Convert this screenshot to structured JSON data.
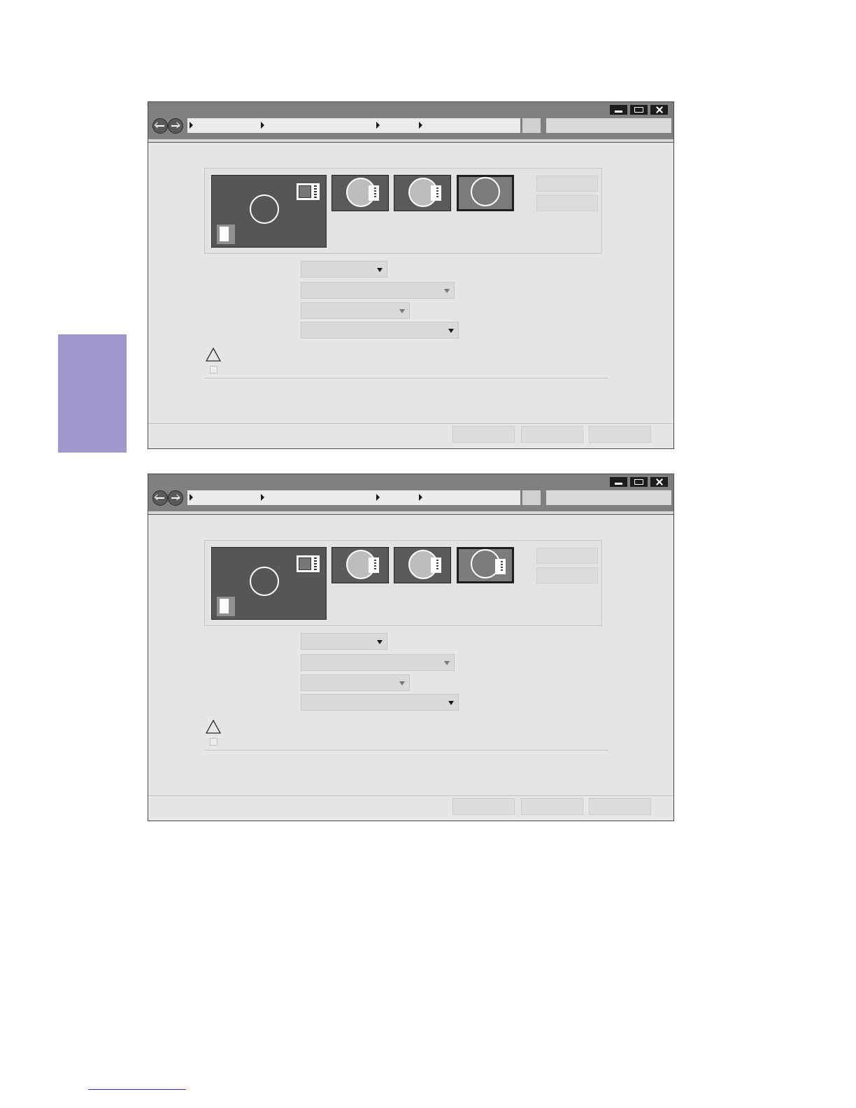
{
  "page": {
    "side_tab_color": "#9e98cc",
    "footer_rule_color": "#2e31c9"
  },
  "windows": [
    {
      "controls": {
        "minimize_icon": "minimize-icon",
        "maximize_icon": "maximize-icon",
        "close_icon": "close-icon"
      },
      "nav": {
        "back_icon": "arrow-left-icon",
        "forward_icon": "arrow-right-icon"
      },
      "address_bar": {
        "breadcrumb_separators": 4
      },
      "preview": {
        "thumbnails": 4,
        "selected_thumbnail": "large"
      },
      "dropdowns": 4,
      "footer_buttons": 3
    },
    {
      "controls": {
        "minimize_icon": "minimize-icon",
        "maximize_icon": "maximize-icon",
        "close_icon": "close-icon"
      },
      "nav": {
        "back_icon": "arrow-left-icon",
        "forward_icon": "arrow-right-icon"
      },
      "address_bar": {
        "breadcrumb_separators": 4
      },
      "preview": {
        "thumbnails": 4,
        "selected_thumbnail": "large"
      },
      "dropdowns": 4,
      "footer_buttons": 3
    }
  ]
}
